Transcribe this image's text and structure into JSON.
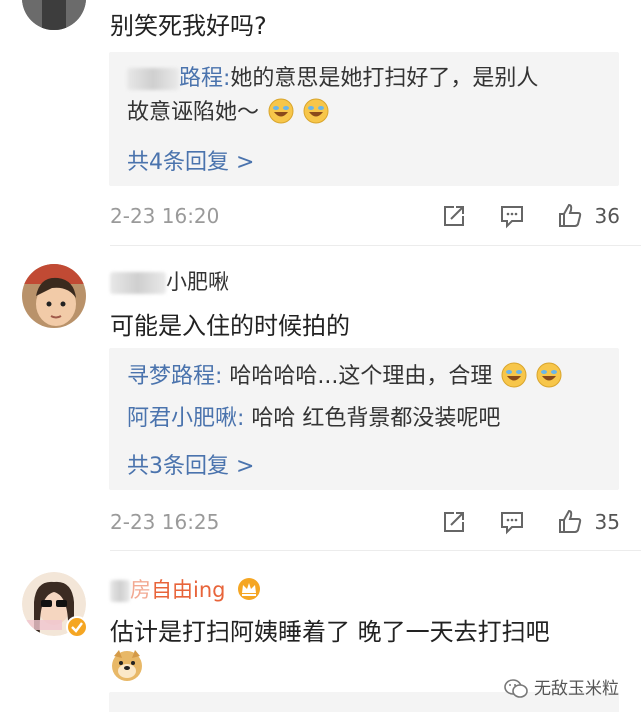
{
  "comment1": {
    "text": "别笑死我好吗?",
    "replies": [
      {
        "name": "路程:",
        "text_line1": "她的意思是她打扫好了，是别人",
        "text_line2": "故意诬陷她～"
      }
    ],
    "more": "共4条回复 >",
    "time": "2-23 16:20",
    "likes": "36"
  },
  "comment2": {
    "username": "小肥啾",
    "text": "可能是入住的时候拍的",
    "replies": [
      {
        "name": "寻梦路程:",
        "text": " 哈哈哈哈...这个理由，合理"
      },
      {
        "name": "阿君小肥啾:",
        "text": " 哈哈 红色背景都没装呢吧"
      }
    ],
    "more": "共3条回复 >",
    "time": "2-23 16:25",
    "likes": "35"
  },
  "comment3": {
    "username_prefix": "房",
    "username": "自由ing",
    "text": "估计是打扫阿姨睡着了 晚了一天去打扫吧"
  },
  "watermark": {
    "text": "无敌玉米粒"
  },
  "icons": {
    "share": "share-icon",
    "comment": "comment-icon",
    "like": "thumbs-up-icon",
    "laugh": "laugh-cry-emoji",
    "doge": "doge-emoji",
    "crown": "crown-badge-icon",
    "verified": "verified-badge-icon",
    "wechat": "wechat-icon"
  },
  "colors": {
    "link": "#4a73ad",
    "reply_bg": "#f4f4f4",
    "meta": "#9a9a9a",
    "badge": "#f5a623"
  }
}
